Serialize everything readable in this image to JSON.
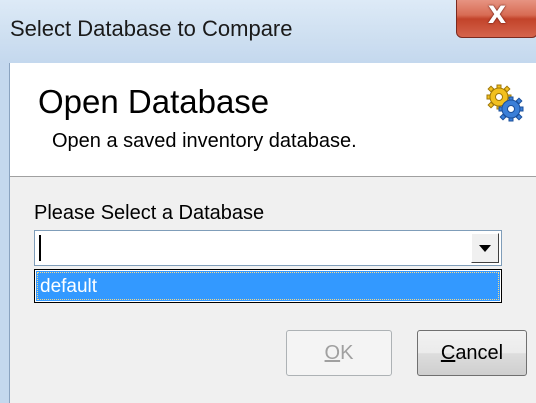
{
  "window": {
    "title": "Select Database to Compare",
    "close_glyph": "X",
    "close_icon": "close-icon"
  },
  "header": {
    "title": "Open Database",
    "subtitle": "Open a saved inventory database.",
    "icon": "gears-icon"
  },
  "form": {
    "label": "Please Select a Database",
    "combo_value": "",
    "combo_icon": "chevron-down-icon",
    "options": [
      "default"
    ],
    "highlighted_option": "default"
  },
  "buttons": {
    "ok": {
      "mnemonic": "O",
      "rest": "K",
      "enabled": false
    },
    "cancel": {
      "mnemonic": "C",
      "rest": "ancel",
      "enabled": true
    }
  },
  "colors": {
    "selection": "#3399ff",
    "disabled_text": "#a0a0a0",
    "close_button": "#c2432a"
  }
}
